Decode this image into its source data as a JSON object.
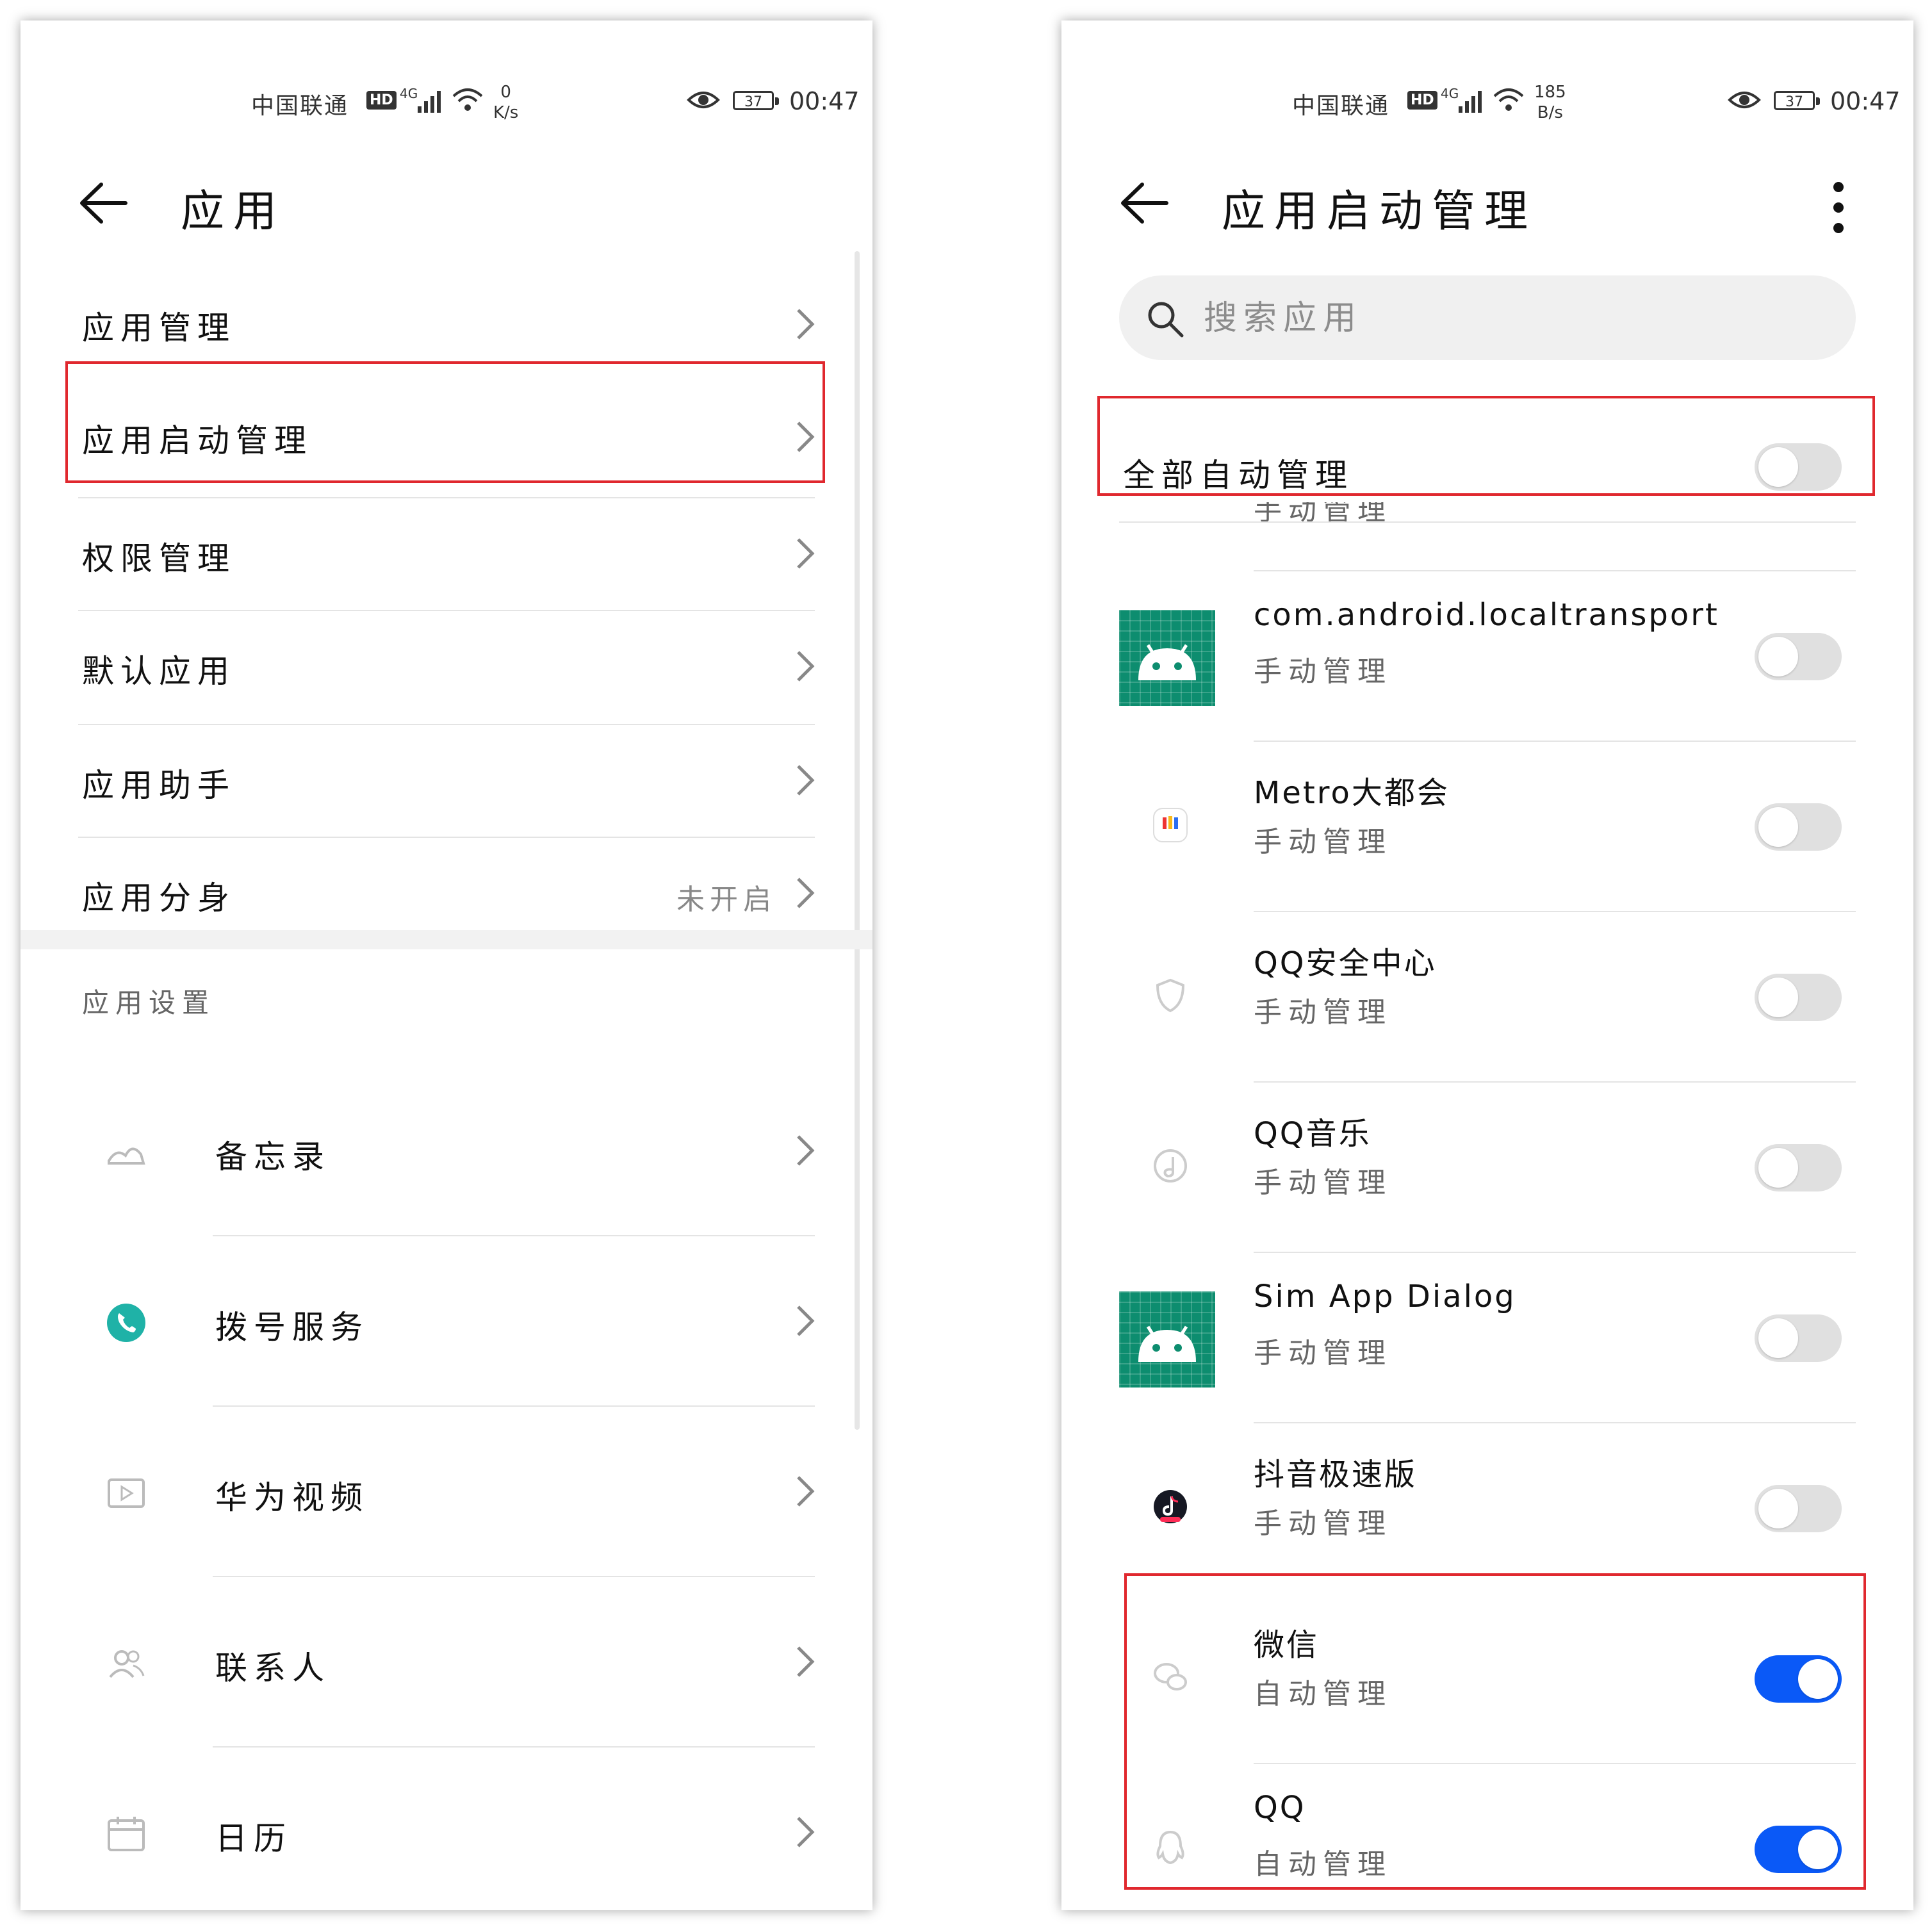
{
  "status": {
    "carrier": "中国联通",
    "hd": "HD",
    "network": "4G",
    "left_speed_value": "0",
    "left_speed_unit": "K/s",
    "right_speed_value": "185",
    "right_speed_unit": "B/s",
    "battery": "37",
    "time": "00:47"
  },
  "left": {
    "title": "应用",
    "menu": [
      {
        "label": "应用管理"
      },
      {
        "label": "应用启动管理"
      },
      {
        "label": "权限管理"
      },
      {
        "label": "默认应用"
      },
      {
        "label": "应用助手"
      },
      {
        "label": "应用分身",
        "hint": "未开启"
      }
    ],
    "section_title": "应用设置",
    "apps": [
      {
        "label": "备忘录",
        "icon": "memo-icon"
      },
      {
        "label": "拨号服务",
        "icon": "phone-icon"
      },
      {
        "label": "华为视频",
        "icon": "video-icon"
      },
      {
        "label": "联系人",
        "icon": "contacts-icon"
      },
      {
        "label": "日历",
        "icon": "calendar-icon"
      }
    ]
  },
  "right": {
    "title": "应用启动管理",
    "search_placeholder": "搜索应用",
    "all_auto_label": "全部自动管理",
    "peek_text": "手动管理",
    "apps": [
      {
        "name": "com.android.localtransport",
        "sub": "手动管理",
        "on": false,
        "icon": "android-icon"
      },
      {
        "name": "Metro大都会",
        "sub": "手动管理",
        "on": false,
        "icon": "metro-icon"
      },
      {
        "name": "QQ安全中心",
        "sub": "手动管理",
        "on": false,
        "icon": "shield-icon"
      },
      {
        "name": "QQ音乐",
        "sub": "手动管理",
        "on": false,
        "icon": "music-icon"
      },
      {
        "name": "Sim App Dialog",
        "sub": "手动管理",
        "on": false,
        "icon": "android-icon"
      },
      {
        "name": "抖音极速版",
        "sub": "手动管理",
        "on": false,
        "icon": "tiktok-icon"
      },
      {
        "name": "微信",
        "sub": "自动管理",
        "on": true,
        "icon": "wechat-icon"
      },
      {
        "name": "QQ",
        "sub": "自动管理",
        "on": true,
        "icon": "qq-icon"
      }
    ],
    "colors": {
      "toggle_on": "#0a59f7",
      "highlight": "#e0282e"
    }
  }
}
